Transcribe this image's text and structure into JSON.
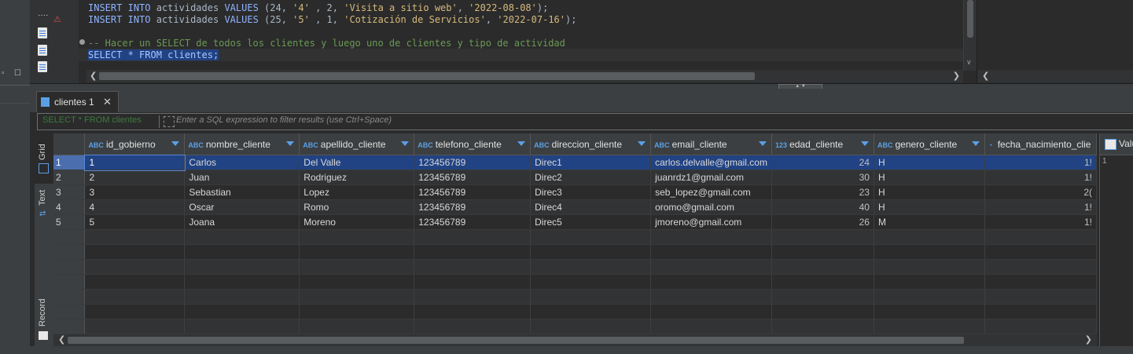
{
  "editor": {
    "line1": {
      "kw1": "INSERT",
      "kw2": "INTO",
      "table": "actividades",
      "kw3": "VALUES",
      "rest_a": " (24, ",
      "s1": "'4'",
      "rest_b": " , 2, ",
      "s2": "'Visita a sitio web'",
      "rest_c": ", ",
      "s3": "'2022-08-08'",
      "end": ");"
    },
    "line2": {
      "kw1": "INSERT",
      "kw2": "INTO",
      "table": "actividades",
      "kw3": "VALUES",
      "rest_a": " (25, ",
      "s1": "'5'",
      "rest_b": " , 1, ",
      "s2": "'Cotización de Servicios'",
      "rest_c": ", ",
      "s3": "'2022-07-16'",
      "end": ");"
    },
    "comment": "-- Hacer un SELECT de todos los clientes y luego uno de clientes y tipo de actividad",
    "query": "SELECT * FROM clientes;"
  },
  "results": {
    "tab_label": "clientes 1",
    "filter_query": "SELECT * FROM clientes",
    "filter_placeholder": "Enter a SQL expression to filter results (use Ctrl+Space)",
    "side_tabs": {
      "grid": "Grid",
      "text": "Text",
      "record": "Record"
    },
    "value_panel_label": "Valu",
    "value_panel_value": "1"
  },
  "grid": {
    "columns": [
      {
        "type": "ABC",
        "name": "id_gobierno"
      },
      {
        "type": "ABC",
        "name": "nombre_cliente"
      },
      {
        "type": "ABC",
        "name": "apellido_cliente"
      },
      {
        "type": "ABC",
        "name": "telefono_cliente"
      },
      {
        "type": "ABC",
        "name": "direccion_cliente"
      },
      {
        "type": "ABC",
        "name": "email_cliente"
      },
      {
        "type": "123",
        "name": "edad_cliente"
      },
      {
        "type": "ABC",
        "name": "genero_cliente"
      },
      {
        "type": "clock",
        "name": "fecha_nacimiento_clie"
      }
    ],
    "rows": [
      {
        "n": "1",
        "id": "1",
        "nombre": "Carlos",
        "apellido": "Del Valle",
        "tel": "123456789",
        "dir": "Direc1",
        "email": "carlos.delvalle@gmail.com",
        "edad": "24",
        "genero": "H",
        "fecha": "1!"
      },
      {
        "n": "2",
        "id": "2",
        "nombre": "Juan",
        "apellido": "Rodriguez",
        "tel": "123456789",
        "dir": "Direc2",
        "email": "juanrdz1@gmail.com",
        "edad": "30",
        "genero": "H",
        "fecha": "1!"
      },
      {
        "n": "3",
        "id": "3",
        "nombre": "Sebastian",
        "apellido": "Lopez",
        "tel": "123456789",
        "dir": "Direc3",
        "email": "seb_lopez@gmail.com",
        "edad": "23",
        "genero": "H",
        "fecha": "2("
      },
      {
        "n": "4",
        "id": "4",
        "nombre": "Oscar",
        "apellido": "Romo",
        "tel": "123456789",
        "dir": "Direc4",
        "email": "oromo@gmail.com",
        "edad": "40",
        "genero": "H",
        "fecha": "1!"
      },
      {
        "n": "5",
        "id": "5",
        "nombre": "Joana",
        "apellido": "Moreno",
        "tel": "123456789",
        "dir": "Direc5",
        "email": "jmoreno@gmail.com",
        "edad": "26",
        "genero": "M",
        "fecha": "1!"
      }
    ]
  },
  "colors": {
    "selection": "#214283",
    "accent": "#5aa0e6",
    "comment": "#6a9955"
  }
}
